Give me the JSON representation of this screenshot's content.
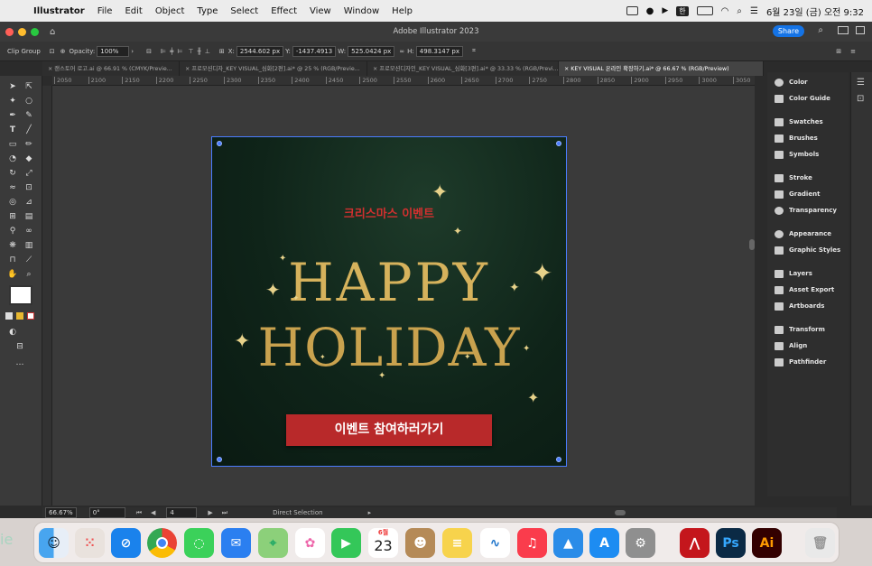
{
  "menubar": {
    "app_name": "Illustrator",
    "items": [
      "File",
      "Edit",
      "Object",
      "Type",
      "Select",
      "Effect",
      "View",
      "Window",
      "Help"
    ],
    "clock": "6월 23일 (금) 오전 9:32",
    "kbd": "한"
  },
  "window": {
    "title": "Adobe Illustrator 2023",
    "share_label": "Share"
  },
  "control_bar": {
    "selection_label": "Clip Group",
    "opacity_label": "Opacity:",
    "opacity_value": "100%",
    "x_label": "X:",
    "x_value": "2544.602 px",
    "y_label": "Y:",
    "y_value": "-1437.4913",
    "w_label": "W:",
    "w_value": "525.0424 px",
    "h_label": "H:",
    "h_value": "498.3147 px"
  },
  "tabs": [
    "랜스토어 로고.ai @ 66.91 % (CMYK/Previe...",
    "프로모션디자_KEY VISUAL_심화[2편].ai* @ 25 % (RGB/Previe...",
    "프로모션디자인_KEY VISUAL_심화[3편].ai* @ 33.33 % (RGB/Previ...",
    "KEY VISUAL 온라인 확장하기.ai* @ 66.67 % (RGB/Preview)"
  ],
  "ruler_marks": [
    "2050",
    "2100",
    "2150",
    "2200",
    "2250",
    "2300",
    "2350",
    "2400",
    "2450",
    "2500",
    "2550",
    "2600",
    "2650",
    "2700",
    "2750",
    "2800",
    "2850",
    "2900",
    "2950",
    "3000",
    "3050"
  ],
  "artwork": {
    "headline": "크리스마스 이벤트",
    "happy": "HAPPY",
    "holiday": "HOLIDAY",
    "cta": "이벤트 참여하러가기",
    "gold": "#d6b25c",
    "red": "#b8292a",
    "bg": "#0f2419"
  },
  "panels": [
    "Color",
    "Color Guide",
    "Swatches",
    "Brushes",
    "Symbols",
    "Stroke",
    "Gradient",
    "Transparency",
    "Appearance",
    "Graphic Styles",
    "Layers",
    "Asset Export",
    "Artboards",
    "Transform",
    "Align",
    "Pathfinder"
  ],
  "status": {
    "zoom": "66.67%",
    "rotation": "0°",
    "artboard": "4",
    "tool": "Direct Selection"
  },
  "dock": {
    "calendar_month": "6월",
    "calendar_day": "23",
    "partial_text": "ie",
    "apps": [
      "finder-icon",
      "launchpad-icon",
      "safari-icon",
      "chrome-icon",
      "messages-icon",
      "mail-icon",
      "maps-icon",
      "photos-icon",
      "facetime-icon",
      "calendar-icon",
      "contacts-icon",
      "notes-icon",
      "freeform-icon",
      "music-icon",
      "keynote-icon",
      "appstore-icon",
      "settings-icon",
      "acrobat-icon",
      "photoshop-icon",
      "illustrator-icon",
      "trash-icon"
    ]
  }
}
